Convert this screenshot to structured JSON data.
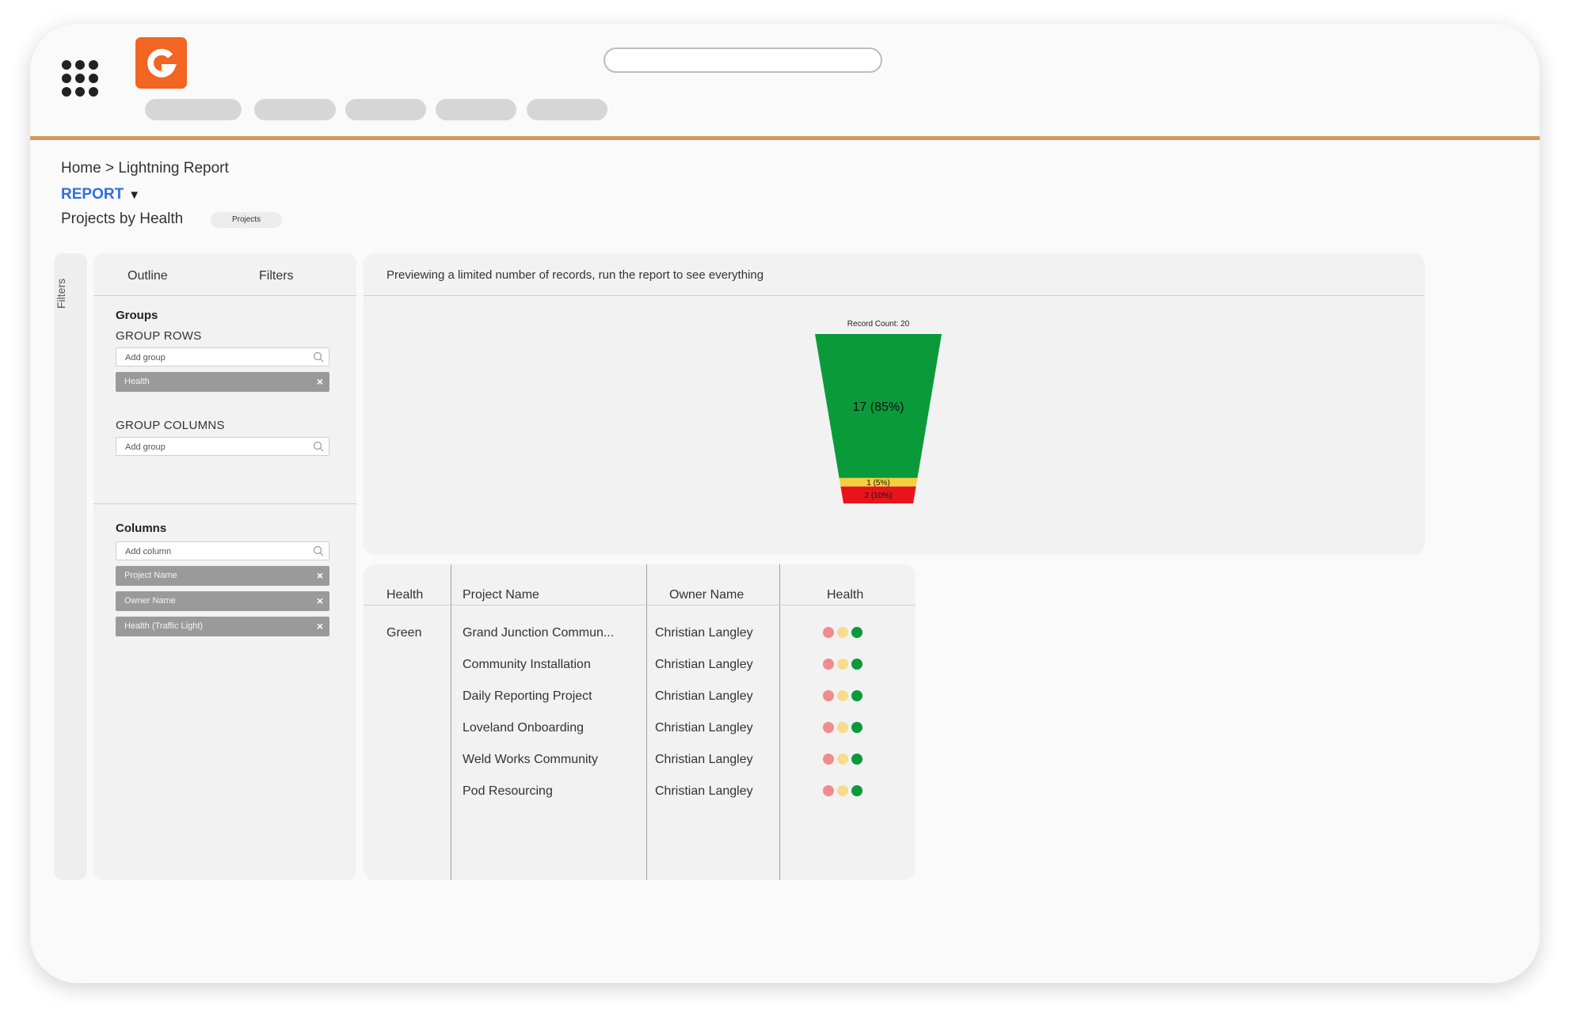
{
  "breadcrumb": "Home > Lightning Report",
  "report_label": "REPORT",
  "report_caret": "▼",
  "page_title": "Projects by Health",
  "object_badge": "Projects",
  "rail_label": "Filters",
  "panel": {
    "tabs": [
      "Outline",
      "Filters"
    ],
    "groups_title": "Groups",
    "group_rows_label": "GROUP ROWS",
    "group_rows_placeholder": "Add group",
    "group_rows_chips": [
      "Health"
    ],
    "group_columns_label": "GROUP COLUMNS",
    "group_columns_placeholder": "Add group",
    "columns_title": "Columns",
    "columns_placeholder": "Add column",
    "column_chips": [
      "Project Name",
      "Owner Name",
      "Health (Traffic Light)"
    ],
    "chip_remove_icon": "×"
  },
  "chart_message": "Previewing a limited number of records, run the report to see everything",
  "chart_data": {
    "type": "funnel",
    "title": "Record Count: 20",
    "segments": [
      {
        "label": "17 (85%)",
        "value": 17,
        "percent": 85,
        "color": "#0b9a3a"
      },
      {
        "label": "1 (5%)",
        "value": 1,
        "percent": 5,
        "color": "#f4d03f"
      },
      {
        "label": "2 (10%)",
        "value": 2,
        "percent": 10,
        "color": "#e8141b"
      }
    ]
  },
  "table": {
    "headers": [
      "Health",
      "Project Name",
      "Owner Name",
      "Health"
    ],
    "group_value": "Green",
    "rows": [
      {
        "project": "Grand Junction Commun...",
        "owner": "Christian Langley"
      },
      {
        "project": "Community Installation",
        "owner": "Christian Langley"
      },
      {
        "project": "Daily Reporting Project",
        "owner": "Christian Langley"
      },
      {
        "project": "Loveland Onboarding",
        "owner": "Christian Langley"
      },
      {
        "project": "Weld Works Community",
        "owner": "Christian Langley"
      },
      {
        "project": "Pod Resourcing",
        "owner": "Christian Langley"
      }
    ],
    "traffic_light_colors": {
      "red": "#f08c8c",
      "yellow": "#f6dc8e",
      "green": "#0b9a3a"
    }
  },
  "colors": {
    "accent_line": "#d39a5b",
    "logo": "#f26522",
    "report_link": "#2f6fe0"
  },
  "icons": {
    "app_launcher": "grid-dots-icon",
    "logo": "g-logo-icon",
    "search": "search-icon"
  }
}
